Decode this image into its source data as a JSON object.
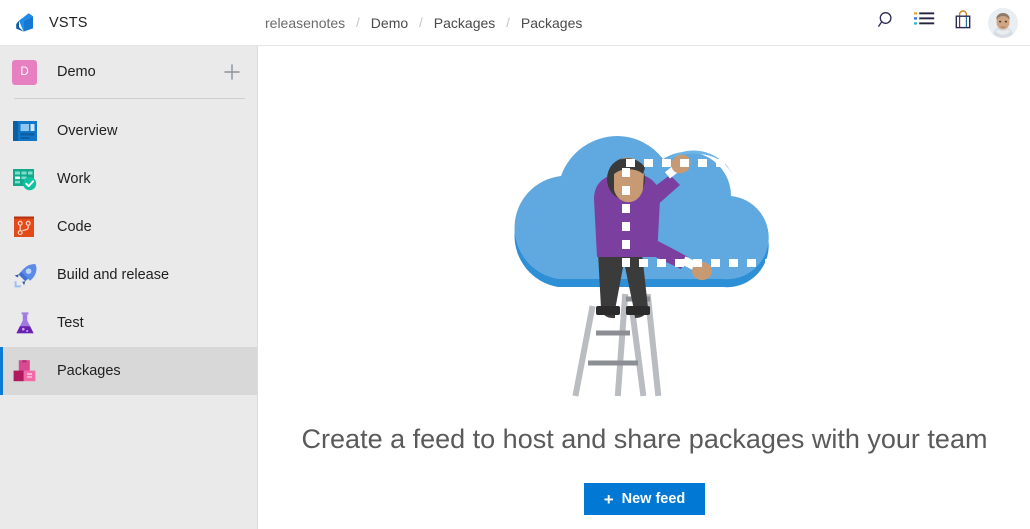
{
  "topbar": {
    "brand": "VSTS",
    "brand_logo_icon": "vsts-logo-icon",
    "breadcrumb": [
      "releasenotes",
      "Demo",
      "Packages",
      "Packages"
    ],
    "breadcrumb_separator": "/",
    "icons": [
      {
        "name": "search-icon",
        "label": "Search"
      },
      {
        "name": "work-items-icon",
        "label": "Work items"
      },
      {
        "name": "marketplace-bag-icon",
        "label": "Marketplace"
      }
    ],
    "avatar_name": "user-avatar"
  },
  "sidebar": {
    "project": {
      "initial": "D",
      "name": "Demo",
      "add_icon": "plus-icon"
    },
    "items": [
      {
        "label": "Overview",
        "icon": "overview-icon",
        "selected": false
      },
      {
        "label": "Work",
        "icon": "work-icon",
        "selected": false
      },
      {
        "label": "Code",
        "icon": "code-icon",
        "selected": false
      },
      {
        "label": "Build and release",
        "icon": "build-icon",
        "selected": false
      },
      {
        "label": "Test",
        "icon": "test-icon",
        "selected": false
      },
      {
        "label": "Packages",
        "icon": "packages-icon",
        "selected": true
      }
    ]
  },
  "main": {
    "illustration_name": "cloud-person-ladder-illustration",
    "headline": "Create a feed to host and share packages with your team",
    "cta_plus": "+",
    "cta_label": "New feed"
  },
  "colors": {
    "accent": "#0078d4",
    "selected_bar": "#0a7bd4",
    "sidebar_bg": "#eaeaea",
    "sidebar_selected_bg": "#d8d8d8",
    "cloud": "#5fa9e0",
    "cloud_shadow": "#2d8fd6",
    "shirt": "#7b3fa0",
    "pants": "#3b3b3b",
    "ladder": "#b9bcc0",
    "headline_color": "#5a5a5a",
    "project_avatar": "#e680c0"
  }
}
